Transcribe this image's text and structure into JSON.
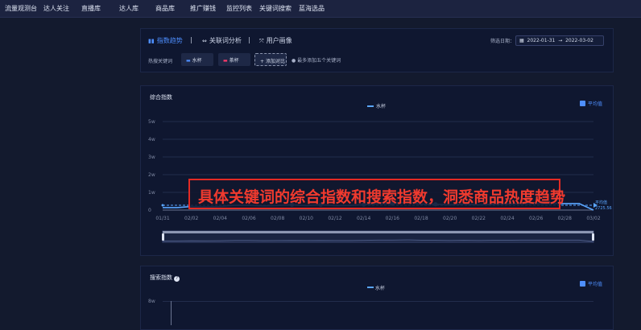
{
  "topnav": {
    "items": [
      "流量观测台",
      "达人关注",
      "直播库",
      "达人库",
      "商品库",
      "推广赚钱",
      "监控列表",
      "关键词搜索",
      "蓝海选品"
    ]
  },
  "tabs": [
    {
      "label": "指数趋势",
      "icon": "bar-chart-icon",
      "active": true
    },
    {
      "label": "关联词分析",
      "icon": "link-icon",
      "active": false
    },
    {
      "label": "用户画像",
      "icon": "user-portrait-icon",
      "active": false
    }
  ],
  "tab_separator": "|",
  "date_filter": {
    "label": "筛选日期：",
    "start": "2022-01-31",
    "to": "→",
    "end": "2022-03-02"
  },
  "keywords": {
    "label": "热搜关键词",
    "chips": [
      {
        "label": "水杯",
        "color": "#4e8fff"
      },
      {
        "label": "茶杯",
        "color": "#ff3a6b"
      }
    ],
    "add_label": "添加对比",
    "hint": "最多添加五个关键词"
  },
  "composite_chart": {
    "title": "综合指数",
    "avg_label": "平均值",
    "avg_value_label": "平均值",
    "avg_value": "2725.56",
    "chart_data": {
      "type": "line",
      "x": [
        "01/31",
        "02/01",
        "02/02",
        "02/03",
        "02/04",
        "02/05",
        "02/06",
        "02/07",
        "02/08",
        "02/09",
        "02/10",
        "02/11",
        "02/12",
        "02/13",
        "02/14",
        "02/15",
        "02/16",
        "02/17",
        "02/18",
        "02/19",
        "02/20",
        "02/21",
        "02/22",
        "02/23",
        "02/24",
        "02/25",
        "02/26",
        "02/27",
        "02/28",
        "03/01",
        "03/02"
      ],
      "x_ticks": [
        "01/31",
        "02/02",
        "02/04",
        "02/06",
        "02/08",
        "02/10",
        "02/12",
        "02/14",
        "02/16",
        "02/18",
        "02/20",
        "02/22",
        "02/24",
        "02/26",
        "02/28",
        "03/02"
      ],
      "y_ticks": [
        "0",
        "1w",
        "2w",
        "3w",
        "4w",
        "5w"
      ],
      "ylim": [
        0,
        50000
      ],
      "series": [
        {
          "name": "水杯",
          "color": "#5aa6ff",
          "values": [
            1400,
            1400,
            2000,
            1800,
            2000,
            2700,
            2700,
            2300,
            2600,
            3000,
            2500,
            3000,
            2500,
            2600,
            3100,
            3600,
            3600,
            4400,
            3300,
            3300,
            2900,
            3400,
            2900,
            3300,
            3500,
            3600,
            3700,
            3700,
            3700,
            3700,
            0
          ]
        }
      ],
      "average": 2725.56,
      "markers": [
        9,
        11,
        14,
        16,
        19
      ]
    }
  },
  "search_chart": {
    "title": "搜索指数",
    "avg_label": "平均值",
    "legend": "水杯",
    "y_tick_top": "8w"
  },
  "banner": {
    "text": "具体关键词的综合指数和搜索指数，洞悉商品热度趋势"
  },
  "colors": {
    "accent": "#4e8fff",
    "line": "#5aa6ff",
    "banner": "#e32a24"
  }
}
